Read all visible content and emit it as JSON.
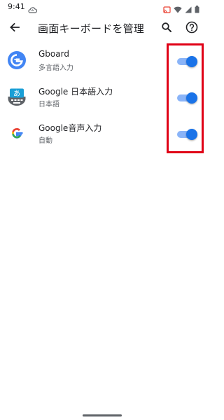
{
  "status_bar": {
    "time": "9:41"
  },
  "app_bar": {
    "title": "画面キーボードを管理"
  },
  "keyboards": [
    {
      "title": "Gboard",
      "subtitle": "多言語入力",
      "enabled": true,
      "icon": "gboard-icon"
    },
    {
      "title": "Google 日本語入力",
      "subtitle": "日本語",
      "enabled": true,
      "icon": "google-japanese-input-icon",
      "icon_glyph": "あ"
    },
    {
      "title": "Google音声入力",
      "subtitle": "自動",
      "enabled": true,
      "icon": "google-g-icon"
    }
  ],
  "colors": {
    "switch_thumb": "#1a73e8",
    "switch_track": "#8ab4f8",
    "highlight": "#e00016",
    "google_blue": "#4285f4",
    "google_red": "#ea4335",
    "google_yellow": "#fbbc05",
    "google_green": "#34a853"
  }
}
